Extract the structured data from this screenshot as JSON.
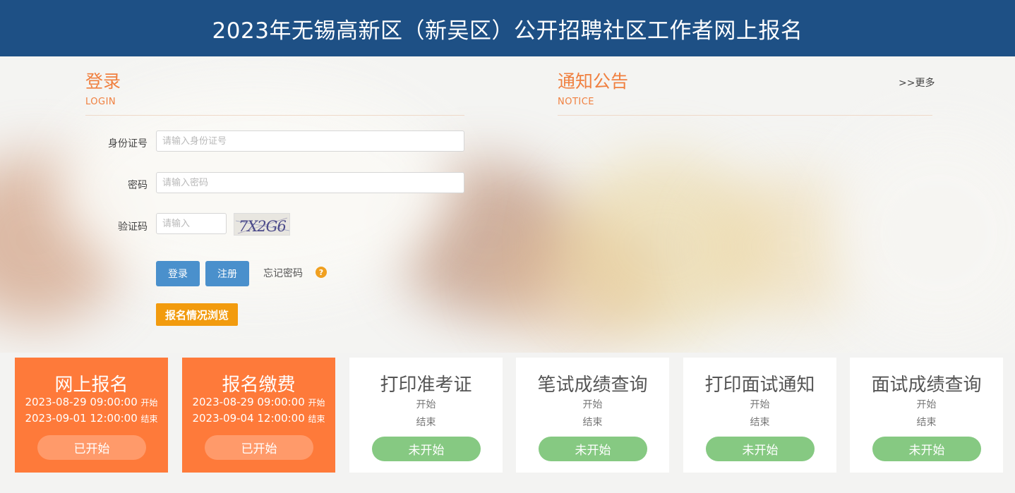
{
  "header": {
    "title": "2023年无锡高新区（新吴区）公开招聘社区工作者网上报名"
  },
  "login": {
    "title": "登录",
    "subtitle": "LOGIN",
    "id_label": "身份证号",
    "id_placeholder": "请输入身份证号",
    "password_label": "密码",
    "password_placeholder": "请输入密码",
    "captcha_label": "验证码",
    "captcha_placeholder": "请输入",
    "captcha_text": "7X2G6",
    "login_button": "登录",
    "register_button": "注册",
    "forgot_password": "忘记密码",
    "help_glyph": "?",
    "browse_button": "报名情况浏览"
  },
  "notice": {
    "title": "通知公告",
    "subtitle": "NOTICE",
    "more": ">>更多"
  },
  "cards": [
    {
      "title": "网上报名",
      "start": "2023-08-29 09:00:00",
      "start_tag": "开始",
      "end": "2023-09-01 12:00:00",
      "end_tag": "结束",
      "status": "已开始",
      "active": true
    },
    {
      "title": "报名缴费",
      "start": "2023-08-29 09:00:00",
      "start_tag": "开始",
      "end": "2023-09-04 12:00:00",
      "end_tag": "结束",
      "status": "已开始",
      "active": true
    },
    {
      "title": "打印准考证",
      "start_tag": "开始",
      "end_tag": "结束",
      "status": "未开始",
      "active": false
    },
    {
      "title": "笔试成绩查询",
      "start_tag": "开始",
      "end_tag": "结束",
      "status": "未开始",
      "active": false
    },
    {
      "title": "打印面试通知",
      "start_tag": "开始",
      "end_tag": "结束",
      "status": "未开始",
      "active": false
    },
    {
      "title": "面试成绩查询",
      "start_tag": "开始",
      "end_tag": "结束",
      "status": "未开始",
      "active": false
    }
  ],
  "colors": {
    "header_bg": "#1e5085",
    "accent_orange": "#f08040",
    "card_active": "#fe7a3a",
    "pill_active": "#ff9a6a",
    "pill_pending": "#86c982",
    "button_blue": "#4a90cc",
    "button_orange": "#f29b0e"
  }
}
